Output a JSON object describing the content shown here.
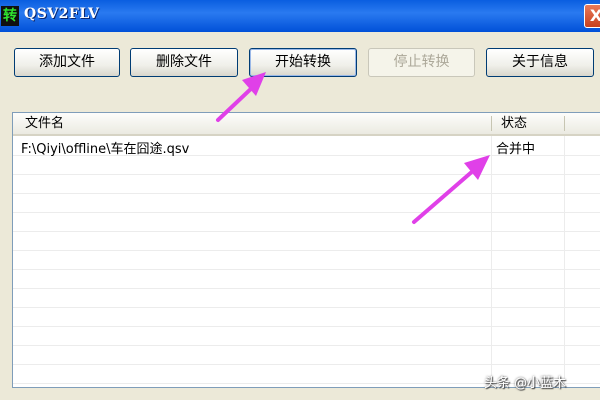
{
  "window": {
    "icon_char": "转",
    "title": "QSV2FLV",
    "close_symbol": "X"
  },
  "toolbar": {
    "add_label": "添加文件",
    "delete_label": "删除文件",
    "start_label": "开始转换",
    "stop_label": "停止转换",
    "about_label": "关于信息"
  },
  "list": {
    "columns": {
      "filename": "文件名",
      "status": "状态"
    },
    "rows": [
      {
        "filename": "F:\\Qiyi\\offline\\车在囧途.qsv",
        "status": "合并中"
      }
    ]
  },
  "annotation": {
    "arrow_color": "#e040e8"
  },
  "watermark": "头条 @小蓝木"
}
